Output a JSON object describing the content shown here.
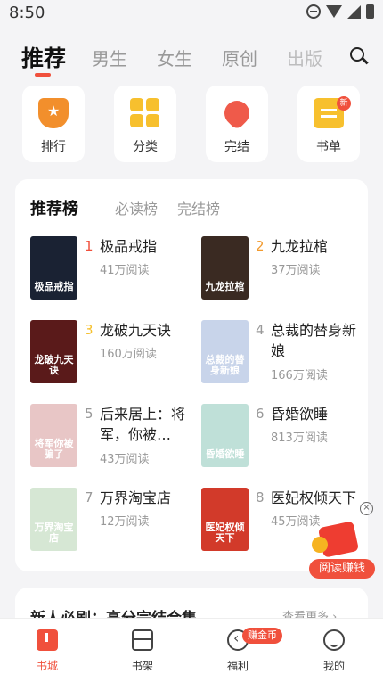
{
  "status_bar": {
    "time": "8:50"
  },
  "top_tabs": [
    {
      "label": "推荐",
      "active": true
    },
    {
      "label": "男生",
      "active": false
    },
    {
      "label": "女生",
      "active": false
    },
    {
      "label": "原创",
      "active": false
    },
    {
      "label": "出版",
      "active": false
    }
  ],
  "quick_nav": [
    {
      "label": "排行",
      "icon": "trophy-icon"
    },
    {
      "label": "分类",
      "icon": "grid-icon"
    },
    {
      "label": "完结",
      "icon": "rocket-icon"
    },
    {
      "label": "书单",
      "icon": "booklist-icon",
      "badge": "新"
    }
  ],
  "rank_tabs": [
    {
      "label": "推荐榜",
      "active": true
    },
    {
      "label": "必读榜",
      "active": false
    },
    {
      "label": "完结榜",
      "active": false
    }
  ],
  "books": [
    {
      "rank": "1",
      "title": "极品戒指",
      "reads": "41万阅读",
      "cover_text": "极品戒指",
      "cover_color": "#1a2233"
    },
    {
      "rank": "2",
      "title": "九龙拉棺",
      "reads": "37万阅读",
      "cover_text": "九龙拉棺",
      "cover_color": "#3a2a22"
    },
    {
      "rank": "3",
      "title": "龙破九天诀",
      "reads": "160万阅读",
      "cover_text": "龙破九天诀",
      "cover_color": "#5a1a1a"
    },
    {
      "rank": "4",
      "title": "总裁的替身新娘",
      "reads": "166万阅读",
      "cover_text": "总裁的替身新娘",
      "cover_color": "#c8d4ea"
    },
    {
      "rank": "5",
      "title": "后来居上：将军，你被…",
      "reads": "43万阅读",
      "cover_text": "将军你被骗了",
      "cover_color": "#e8c6c6"
    },
    {
      "rank": "6",
      "title": "昏婚欲睡",
      "reads": "813万阅读",
      "cover_text": "昏婚欲睡",
      "cover_color": "#bfe0d8"
    },
    {
      "rank": "7",
      "title": "万界淘宝店",
      "reads": "12万阅读",
      "cover_text": "万界淘宝店",
      "cover_color": "#d6e7d4"
    },
    {
      "rank": "8",
      "title": "医妃权倾天下",
      "reads": "45万阅读",
      "cover_text": "医妃权倾天下",
      "cover_color": "#d23a2a"
    }
  ],
  "rank_colors": {
    "top1": "#f0503c",
    "top2": "#f29a2e",
    "top3": "#f5c02e",
    "other": "#999999"
  },
  "floating_ad": {
    "close": "×",
    "label": "阅读赚钱"
  },
  "bottom_section": {
    "title": "新人必刷：高分完结合集",
    "more": "查看更多 ›"
  },
  "tabbar": [
    {
      "label": "书城",
      "active": true
    },
    {
      "label": "书架",
      "active": false
    },
    {
      "label": "福利",
      "active": false,
      "badge": "赚金币"
    },
    {
      "label": "我的",
      "active": false
    }
  ],
  "accent_color": "#f0503c"
}
